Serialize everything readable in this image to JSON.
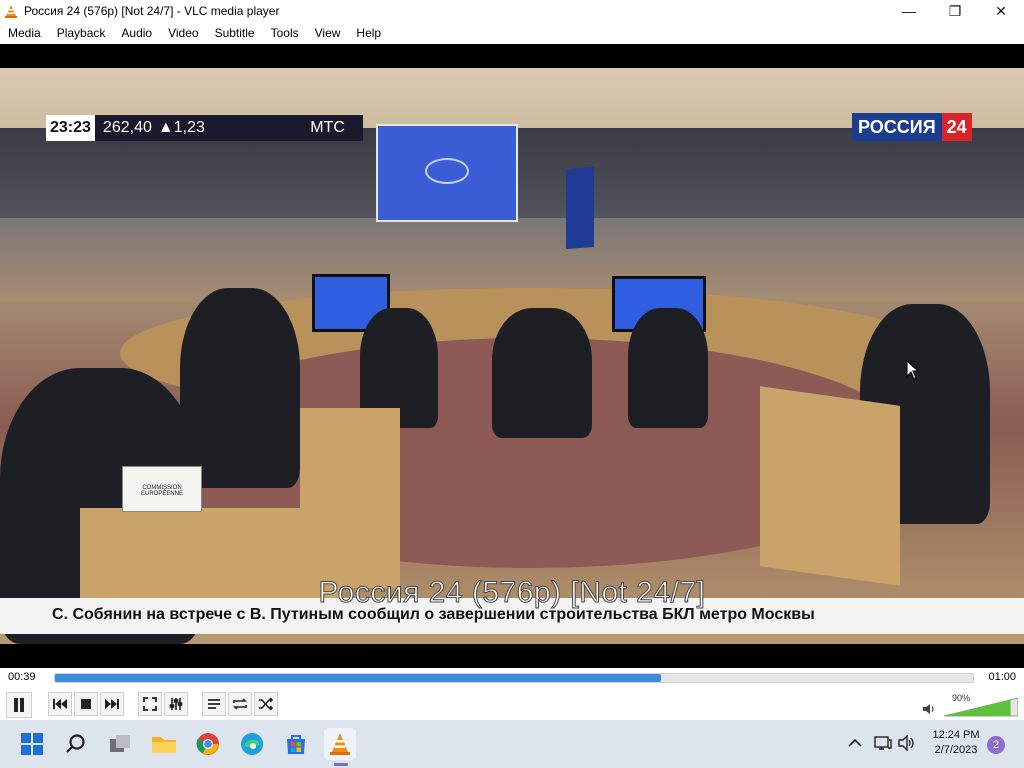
{
  "window": {
    "title": "Россия 24 (576p) [Not 24/7] - VLC media player",
    "minimize_glyph": "—",
    "maximize_glyph": "❐",
    "close_glyph": "✕"
  },
  "menu": [
    "Media",
    "Playback",
    "Audio",
    "Video",
    "Subtitle",
    "Tools",
    "View",
    "Help"
  ],
  "video": {
    "overlay_clock": "23:23",
    "ticker_value": "262,40",
    "ticker_change": "▲1,23",
    "ticker_source": "МТС",
    "channel_name": "РОССИЯ",
    "channel_number": "24",
    "news_caption": "С. Собянин на встрече с В. Путиным сообщил о завершении строительства БКЛ метро Москвы",
    "osd_title": "Россия 24 (576p) [Not 24/7]",
    "placard_text": "COMMISSION EUROPÉENNE"
  },
  "playback": {
    "current_time": "00:39",
    "total_time": "01:00",
    "progress_fraction": 0.66,
    "volume_label": "90%",
    "volume_fraction": 0.9
  },
  "controls": [
    "pause-icon",
    "previous-icon",
    "stop-icon",
    "next-icon",
    "fullscreen-icon",
    "extended-settings-icon",
    "playlist-icon",
    "loop-icon",
    "shuffle-icon",
    "volume-icon"
  ],
  "taskbar": {
    "icons": [
      "windows-start-icon",
      "search-icon",
      "task-view-icon",
      "file-explorer-icon",
      "chrome-icon",
      "edge-icon",
      "microsoft-store-icon",
      "vlc-icon"
    ],
    "time": "12:24 PM",
    "date": "2/7/2023",
    "notification_count": "2",
    "accent_color": "#7a6cbf"
  }
}
